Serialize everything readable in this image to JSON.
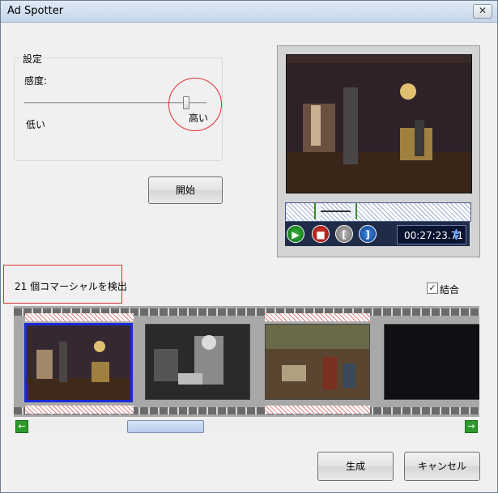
{
  "window": {
    "title": "Ad Spotter",
    "close_glyph": "✕"
  },
  "settings": {
    "group_label": "設定",
    "sensitivity_label": "感度:",
    "low_label": "低い",
    "high_label": "高い",
    "slider_level": 0.9
  },
  "start_button": "開始",
  "player": {
    "time": "00:27:23.71",
    "controls": [
      {
        "name": "play-icon",
        "glyph": "▶"
      },
      {
        "name": "stop-icon",
        "glyph": "■"
      },
      {
        "name": "mark-in-icon",
        "glyph": "["
      },
      {
        "name": "mark-out-icon",
        "glyph": "]"
      }
    ]
  },
  "detection": {
    "text": "21 個コマーシャルを検出"
  },
  "combine": {
    "label": "結合",
    "checked": true,
    "check_glyph": "✓"
  },
  "scroll": {
    "left_glyph": "←",
    "right_glyph": "→"
  },
  "buttons": {
    "generate": "生成",
    "cancel": "キャンセル"
  }
}
